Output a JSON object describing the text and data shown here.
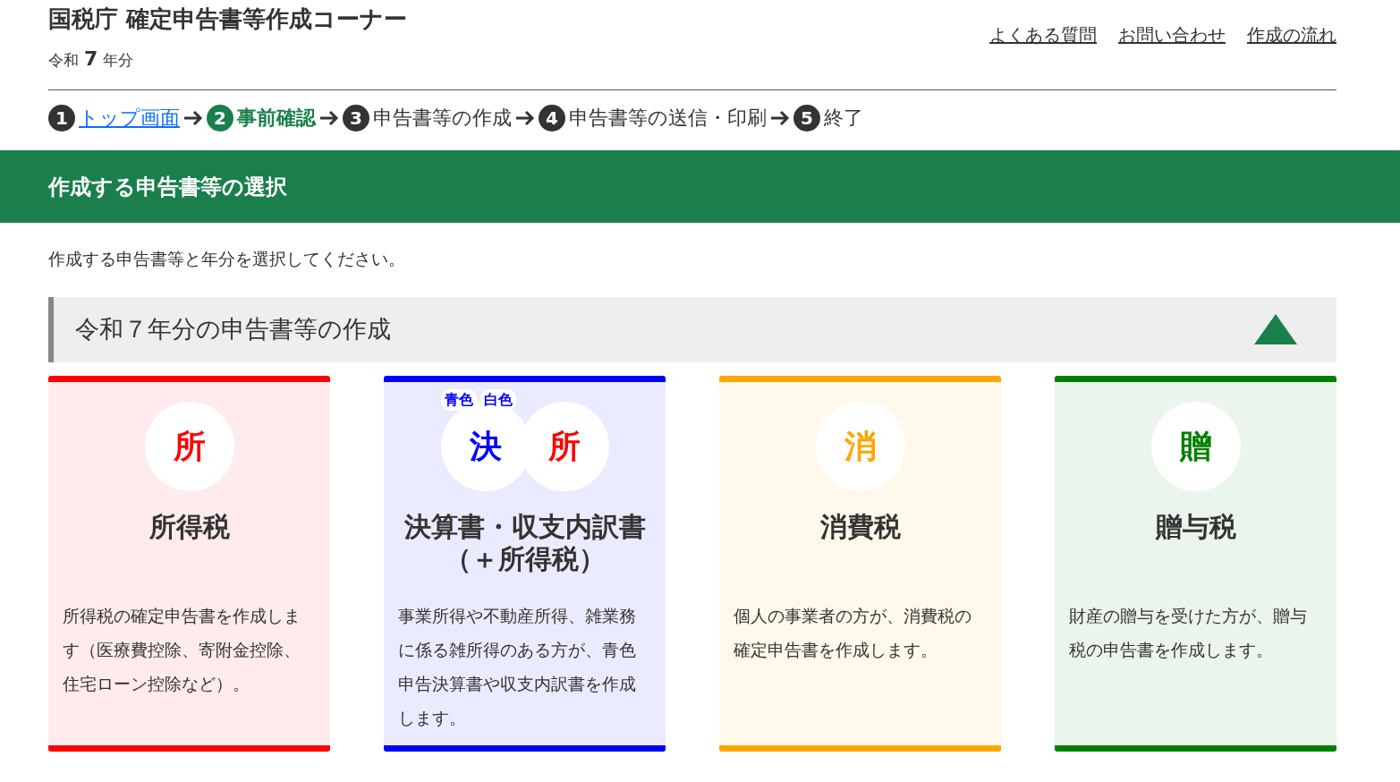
{
  "header": {
    "title": "国税庁 確定申告書等作成コーナー",
    "era": "令和",
    "year": "7",
    "year_suffix": "年分",
    "links": [
      "よくある質問",
      "お問い合わせ",
      "作成の流れ"
    ]
  },
  "steps": [
    {
      "number": "1",
      "label": "トップ画面",
      "kind": "link",
      "selected": false
    },
    {
      "number": "2",
      "label": "事前確認",
      "kind": "text",
      "selected": true
    },
    {
      "number": "3",
      "label": "申告書等の作成",
      "kind": "text",
      "selected": false
    },
    {
      "number": "4",
      "label": "申告書等の送信・印刷",
      "kind": "text",
      "selected": false
    },
    {
      "number": "5",
      "label": "終了",
      "kind": "text",
      "selected": false
    }
  ],
  "banner": {
    "title": "作成する申告書等の選択"
  },
  "intro": "作成する申告書等と年分を選択してください。",
  "section": {
    "title": "令和７年分の申告書等の作成",
    "expanded": true
  },
  "cards": [
    {
      "title": "所得税",
      "description": "所得税の確定申告書を作成します（医療費控除、寄附金控除、住宅ローン控除など）。",
      "color": "#ff0000",
      "icons": [
        {
          "char": "所",
          "color": "#ff0000"
        }
      ]
    },
    {
      "title": "決算書・収支内訳書（＋所得税）",
      "description": "事業所得や不動産所得、雑業務に係る雑所得のある方が、青色申告決算書や収支内訳書を作成します。",
      "color": "#0000ff",
      "icons": [
        {
          "char": "決",
          "color": "#0000ff",
          "tags": [
            "青色",
            "白色"
          ]
        },
        {
          "char": "所",
          "color": "#ff0000"
        }
      ]
    },
    {
      "title": "消費税",
      "description": "個人の事業者の方が、消費税の確定申告書を作成します。",
      "color": "#ffa500",
      "icons": [
        {
          "char": "消",
          "color": "#ffa500"
        }
      ]
    },
    {
      "title": "贈与税",
      "description": "財産の贈与を受けた方が、贈与税の申告書を作成します。",
      "color": "#008000",
      "icons": [
        {
          "char": "贈",
          "color": "#008000"
        }
      ]
    }
  ]
}
